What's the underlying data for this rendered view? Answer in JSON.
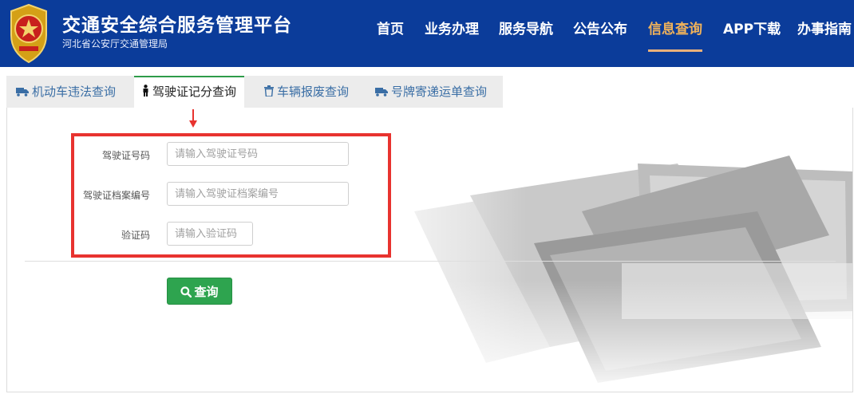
{
  "header": {
    "title": "交通安全综合服务管理平台",
    "subtitle": "河北省公安厅交通管理局",
    "nav": [
      {
        "label": "首页",
        "active": false
      },
      {
        "label": "业务办理",
        "active": false
      },
      {
        "label": "服务导航",
        "active": false
      },
      {
        "label": "公告公布",
        "active": false
      },
      {
        "label": "信息查询",
        "active": true
      },
      {
        "label": "APP下载",
        "active": false
      },
      {
        "label": "办事指南",
        "active": false
      }
    ],
    "colors": {
      "bar": "#0b3c9a",
      "active_nav": "#f0b25a"
    }
  },
  "tabs": [
    {
      "label": "机动车违法查询",
      "icon": "truck-icon",
      "active": false
    },
    {
      "label": "驾驶证记分查询",
      "icon": "person-icon",
      "active": true
    },
    {
      "label": "车辆报废查询",
      "icon": "trash-icon",
      "active": false
    },
    {
      "label": "号牌寄递运单查询",
      "icon": "truck-icon",
      "active": false
    }
  ],
  "form": {
    "license_no": {
      "label": "驾驶证号码",
      "placeholder": "请输入驾驶证号码",
      "value": ""
    },
    "file_no": {
      "label": "驾驶证档案编号",
      "placeholder": "请输入驾驶证档案编号",
      "value": ""
    },
    "captcha": {
      "label": "验证码",
      "placeholder": "请输入验证码",
      "value": ""
    },
    "submit_label": "查询"
  },
  "colors": {
    "highlight": "#e8332f",
    "button": "#2ea44f",
    "tab_accent": "#2e9c4a"
  }
}
